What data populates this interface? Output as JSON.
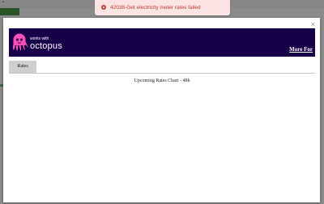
{
  "toast": {
    "icon": "error-circle-icon",
    "message": "42038-Get electricity meter rates failed",
    "color": "#c0392b",
    "background": "#fce4e4"
  },
  "modal": {
    "close_label": "×",
    "banner": {
      "logo_small_text": "works with",
      "logo_brand_text": "octopus",
      "link_label": "More For",
      "background": "#180048",
      "logo_color": "#ff4fb8"
    },
    "tabs": [
      {
        "label": "Rates",
        "active": true
      }
    ],
    "chart_title": "Upcoming Rates Chart - 48h"
  },
  "background": {
    "corner_glyph": "◔"
  }
}
